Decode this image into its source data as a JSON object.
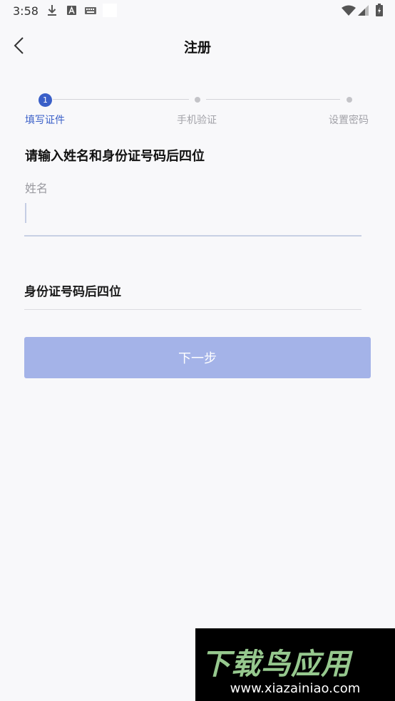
{
  "status_bar": {
    "time": "3:58"
  },
  "header": {
    "title": "注册"
  },
  "steps": [
    {
      "number": "1",
      "label": "填写证件"
    },
    {
      "label": "手机验证"
    },
    {
      "label": "设置密码"
    }
  ],
  "form": {
    "instruction": "请输入姓名和身份证号码后四位",
    "name_label": "姓名",
    "name_value": "",
    "id_placeholder": "身份证号码后四位",
    "next_label": "下一步"
  },
  "watermark": {
    "logo": "下载鸟应用",
    "url": "www.xiazainiao.com"
  },
  "colors": {
    "accent": "#3a5fc8",
    "button": "#a4b3e8"
  }
}
